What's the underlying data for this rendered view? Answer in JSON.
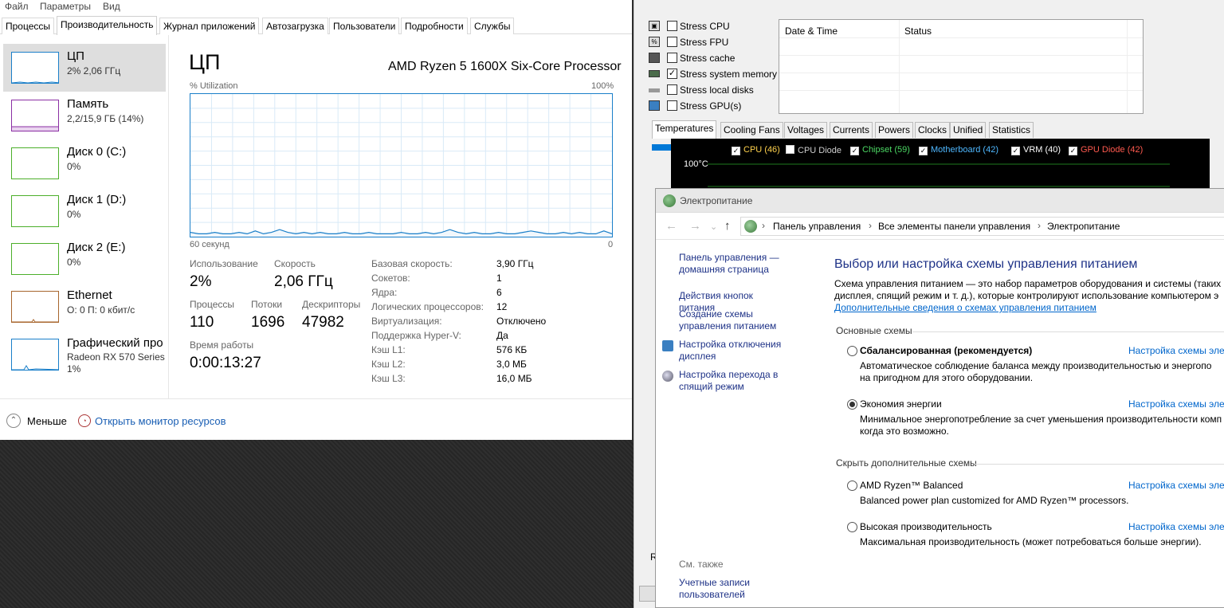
{
  "task_manager": {
    "menu": [
      "Файл",
      "Параметры",
      "Вид"
    ],
    "tabs": [
      "Процессы",
      "Производительность",
      "Журнал приложений",
      "Автозагрузка",
      "Пользователи",
      "Подробности",
      "Службы"
    ],
    "active_tab": "Производительность",
    "sidebar": [
      {
        "title": "ЦП",
        "sub": "2% 2,06 ГГц",
        "sub2": "",
        "color": "#1a7fc9"
      },
      {
        "title": "Память",
        "sub": "2,2/15,9 ГБ (14%)",
        "sub2": "",
        "color": "#8b2fa3"
      },
      {
        "title": "Диск 0 (C:)",
        "sub": "0%",
        "sub2": "",
        "color": "#4caf2a"
      },
      {
        "title": "Диск 1 (D:)",
        "sub": "0%",
        "sub2": "",
        "color": "#4caf2a"
      },
      {
        "title": "Диск 2 (E:)",
        "sub": "0%",
        "sub2": "",
        "color": "#4caf2a"
      },
      {
        "title": "Ethernet",
        "sub": "О: 0 П: 0 кбит/с",
        "sub2": "",
        "color": "#a7652c"
      },
      {
        "title": "Графический про",
        "sub": "Radeon RX 570 Series",
        "sub2": "1%",
        "color": "#1a7fc9"
      }
    ],
    "cpu": {
      "heading": "ЦП",
      "model": "AMD Ryzen 5 1600X Six-Core Processor",
      "util_label": "% Utilization",
      "util_max": "100%",
      "graph_left": "60 секунд",
      "graph_right": "0",
      "usage_history": [
        3,
        2,
        2,
        3,
        2,
        2,
        3,
        2,
        4,
        2,
        3,
        5,
        3,
        2,
        3,
        2,
        3,
        2,
        2,
        3,
        2,
        2,
        3,
        2,
        2,
        2,
        3,
        2,
        2,
        3,
        2,
        3,
        5,
        3,
        2,
        3,
        2,
        2,
        3,
        2,
        2,
        3,
        4,
        3,
        2,
        2,
        3,
        2,
        3,
        2,
        2,
        4,
        2
      ],
      "stats": [
        {
          "label": "Использование",
          "value": "2%"
        },
        {
          "label": "Скорость",
          "value": "2,06 ГГц"
        },
        {
          "label": "Процессы",
          "value": "110"
        },
        {
          "label": "Потоки",
          "value": "1696"
        },
        {
          "label": "Дескрипторы",
          "value": "47982"
        },
        {
          "label": "Время работы",
          "value": "0:00:13:27"
        }
      ],
      "specs": [
        {
          "label": "Базовая скорость:",
          "value": "3,90 ГГц"
        },
        {
          "label": "Сокетов:",
          "value": "1"
        },
        {
          "label": "Ядра:",
          "value": "6"
        },
        {
          "label": "Логических процессоров:",
          "value": "12"
        },
        {
          "label": "Виртуализация:",
          "value": "Отключено"
        },
        {
          "label": "Поддержка Hyper-V:",
          "value": "Да"
        },
        {
          "label": "Кэш L1:",
          "value": "576 КБ"
        },
        {
          "label": "Кэш L2:",
          "value": "3,0 МБ"
        },
        {
          "label": "Кэш L3:",
          "value": "16,0 МБ"
        }
      ]
    },
    "footer": {
      "fewer": "Меньше",
      "resmon": "Открыть монитор ресурсов"
    }
  },
  "aida": {
    "stress_options": [
      {
        "label": "Stress CPU",
        "checked": false
      },
      {
        "label": "Stress FPU",
        "checked": false
      },
      {
        "label": "Stress cache",
        "checked": false
      },
      {
        "label": "Stress system memory",
        "checked": true
      },
      {
        "label": "Stress local disks",
        "checked": false
      },
      {
        "label": "Stress GPU(s)",
        "checked": false
      }
    ],
    "log_headers": [
      "Date & Time",
      "Status"
    ],
    "tabs": [
      "Temperatures",
      "Cooling Fans",
      "Voltages",
      "Currents",
      "Powers",
      "Clocks",
      "Unified",
      "Statistics"
    ],
    "legend": [
      {
        "label": "CPU (46)",
        "checked": true,
        "color": "#ffd24d"
      },
      {
        "label": "CPU Diode",
        "checked": false,
        "color": "#cfcfcf"
      },
      {
        "label": "Chipset (59)",
        "checked": true,
        "color": "#4cd964"
      },
      {
        "label": "Motherboard (42)",
        "checked": true,
        "color": "#4fb8ff"
      },
      {
        "label": "VRM (40)",
        "checked": true,
        "color": "#ffffff"
      },
      {
        "label": "GPU Diode (42)",
        "checked": true,
        "color": "#ff5a4f"
      }
    ],
    "temp_max": "100°C",
    "bottom_letter": "R"
  },
  "power": {
    "title": "Электропитание",
    "breadcrumbs": [
      "Панель управления",
      "Все элементы панели управления",
      "Электропитание"
    ],
    "sidebar": [
      {
        "text": "Панель управления — домашняя страница",
        "icon": ""
      },
      {
        "text": "Действия кнопок питания",
        "icon": ""
      },
      {
        "text": "Создание схемы управления питанием",
        "icon": ""
      },
      {
        "text": "Настройка отключения дисплея",
        "icon": "display-icon"
      },
      {
        "text": "Настройка перехода в спящий режим",
        "icon": "sleep-icon"
      }
    ],
    "see_also": "См. также",
    "see_also_link": "Учетные записи пользователей",
    "heading": "Выбор или настройка схемы управления питанием",
    "desc1": "Схема управления питанием — это набор параметров оборудования и системы (таких к",
    "desc2": "дисплея, спящий режим и т. д.), которые контролируют использование компьютером э",
    "more_link": "Дополнительные сведения о схемах управления питанием",
    "main_section": "Основные схемы",
    "hidden_section": "Скрыть дополнительные схемы",
    "plans": [
      {
        "name": "Сбалансированная (рекомендуется)",
        "bold": true,
        "checked": false,
        "desc1": "Автоматическое соблюдение баланса между производительностью и энергопо",
        "desc2": "на пригодном для этого оборудовании.",
        "link": "Настройка схемы эле"
      },
      {
        "name": "Экономия энергии",
        "bold": false,
        "checked": true,
        "desc1": "Минимальное энергопотребление за счет уменьшения производительности комп",
        "desc2": "когда это возможно.",
        "link": "Настройка схемы эле"
      },
      {
        "name": "AMD Ryzen™ Balanced",
        "bold": false,
        "checked": false,
        "desc1": "Balanced power plan customized for AMD Ryzen™ processors.",
        "desc2": "",
        "link": "Настройка схемы эле"
      },
      {
        "name": "Высокая производительность",
        "bold": false,
        "checked": false,
        "desc1": "Максимальная производительность (может потребоваться больше энергии).",
        "desc2": "",
        "link": "Настройка схемы эле"
      }
    ]
  }
}
